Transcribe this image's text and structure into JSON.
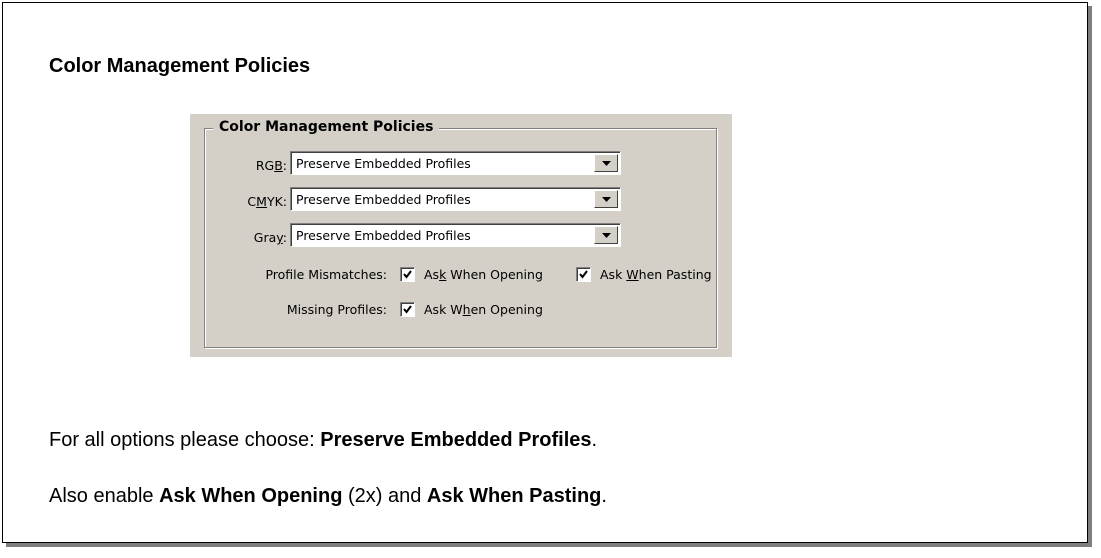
{
  "heading": "Color Management Policies",
  "dialog": {
    "group_title": "Color Management Policies",
    "rgb": {
      "label_pre": "RG",
      "label_acc": "B",
      "label_post": ":",
      "value": "Preserve Embedded Profiles"
    },
    "cmyk": {
      "label_pre": "C",
      "label_acc": "M",
      "label_post": "YK:",
      "value": "Preserve Embedded Profiles"
    },
    "gray": {
      "label_pre": "Gra",
      "label_acc": "y",
      "label_post": ":",
      "value": "Preserve Embedded Profiles"
    },
    "profile_mismatches": {
      "label": "Profile Mismatches:",
      "ask_opening": {
        "pre": "As",
        "acc": "k",
        "post": " When Opening",
        "checked": true
      },
      "ask_pasting": {
        "pre": "Ask ",
        "acc": "W",
        "post": "hen Pasting",
        "checked": true
      }
    },
    "missing_profiles": {
      "label": "Missing Profiles:",
      "ask_opening": {
        "pre": "Ask W",
        "acc": "h",
        "post": "en Opening",
        "checked": true
      }
    }
  },
  "instructions": {
    "line1_pre": "For all options please choose: ",
    "line1_bold": "Preserve Embedded Profiles",
    "line1_post": ".",
    "line2_pre": "Also enable ",
    "line2_bold1": "Ask When Opening",
    "line2_mid": " (2x) and ",
    "line2_bold2": "Ask When Pasting",
    "line2_post": "."
  }
}
